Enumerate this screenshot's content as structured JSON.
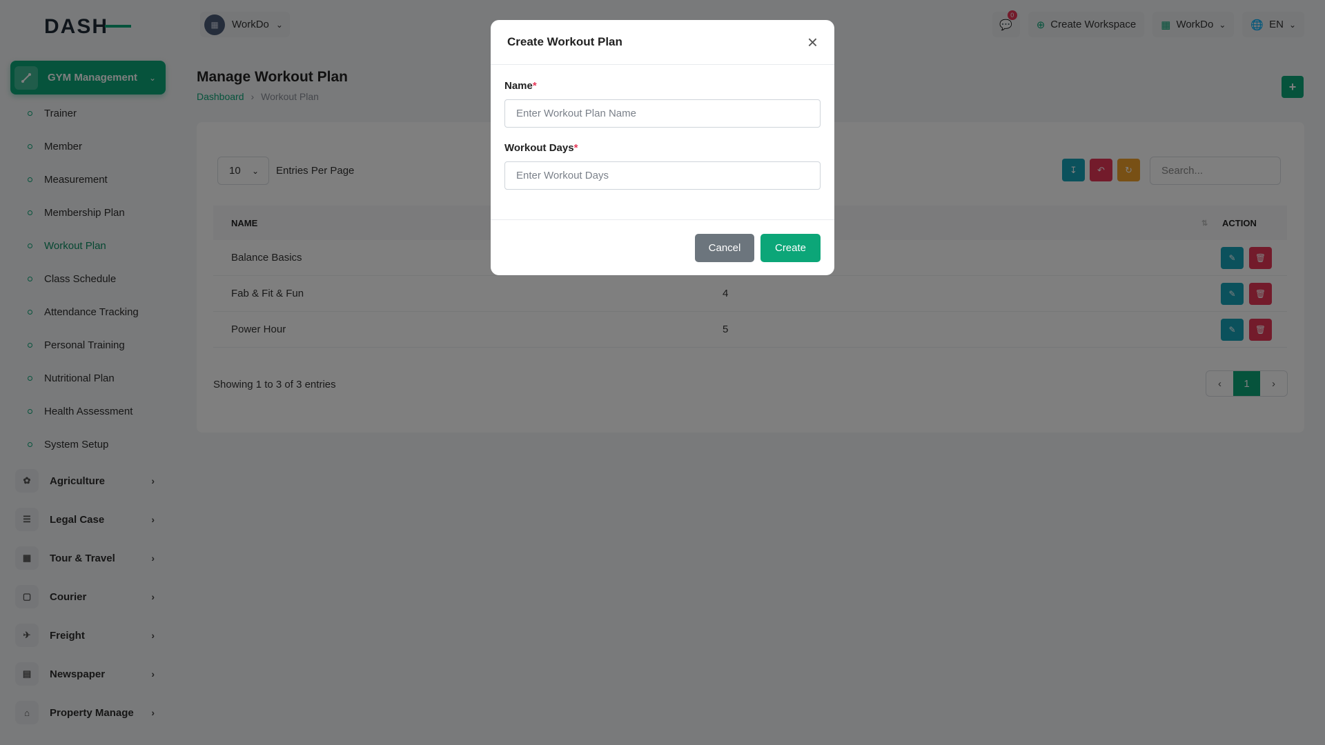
{
  "app": {
    "workspace": "WorkDo",
    "notification_count": "0",
    "create_workspace": "Create Workspace",
    "workspace_menu": "WorkDo",
    "language": "EN"
  },
  "sidebar": {
    "active_module": "GYM Management",
    "subitems": [
      {
        "label": "Trainer"
      },
      {
        "label": "Member"
      },
      {
        "label": "Measurement"
      },
      {
        "label": "Membership Plan"
      },
      {
        "label": "Workout Plan",
        "active": true
      },
      {
        "label": "Class Schedule"
      },
      {
        "label": "Attendance Tracking"
      },
      {
        "label": "Personal Training"
      },
      {
        "label": "Nutritional Plan"
      },
      {
        "label": "Health Assessment"
      },
      {
        "label": "System Setup"
      }
    ],
    "modules": [
      {
        "label": "Agriculture",
        "icon": "plant-icon"
      },
      {
        "label": "Legal Case",
        "icon": "list-icon"
      },
      {
        "label": "Tour & Travel",
        "icon": "grid-icon"
      },
      {
        "label": "Courier",
        "icon": "box-icon"
      },
      {
        "label": "Freight",
        "icon": "plane-icon"
      },
      {
        "label": "Newspaper",
        "icon": "newspaper-icon"
      },
      {
        "label": "Property Manage",
        "icon": "building-icon"
      }
    ]
  },
  "page": {
    "title": "Manage Workout Plan",
    "breadcrumb": [
      "Dashboard",
      "Workout Plan"
    ]
  },
  "table": {
    "entries_per_page_value": "10",
    "entries_per_page_label": "Entries Per Page",
    "search_placeholder": "Search...",
    "headers": {
      "name": "NAME",
      "action": "ACTION"
    },
    "rows": [
      {
        "name": "Balance Basics",
        "days": ""
      },
      {
        "name": "Fab & Fit & Fun",
        "days": "4"
      },
      {
        "name": "Power Hour",
        "days": "5"
      }
    ],
    "showing": "Showing 1 to 3 of 3 entries",
    "current_page": "1"
  },
  "modal": {
    "title": "Create Workout Plan",
    "name_label": "Name",
    "name_placeholder": "Enter Workout Plan Name",
    "days_label": "Workout Days",
    "days_placeholder": "Enter Workout Days",
    "cancel": "Cancel",
    "create": "Create"
  },
  "colors": {
    "primary": "#0ca678",
    "danger": "#e63757",
    "info": "#17a2b8",
    "warning": "#f0a02b",
    "secondary": "#6c757d"
  }
}
